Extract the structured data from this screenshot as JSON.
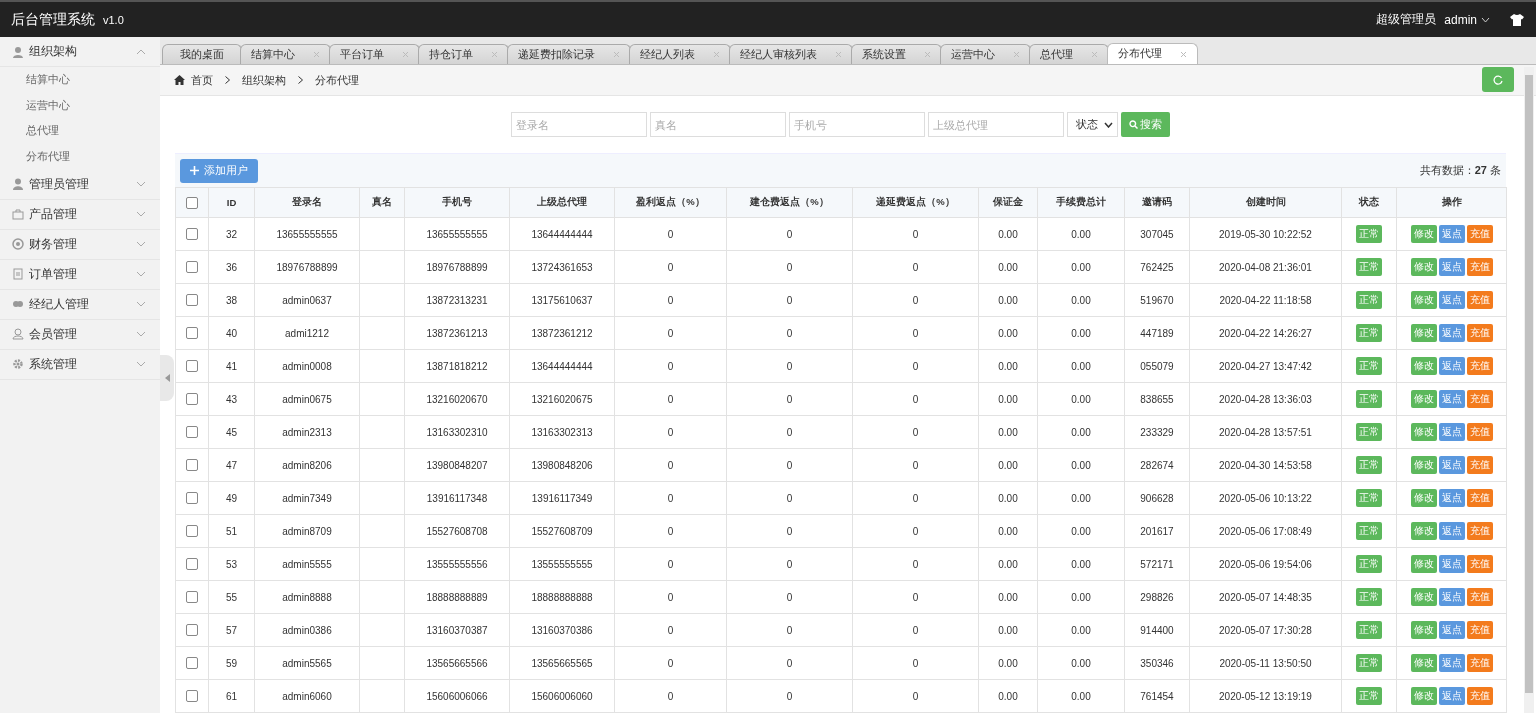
{
  "header": {
    "title": "后台管理系统",
    "version": "v1.0",
    "role": "超级管理员",
    "user": "admin"
  },
  "sidebar": [
    {
      "label": "组织架构",
      "expanded": true,
      "children": [
        {
          "label": "结算中心"
        },
        {
          "label": "运营中心"
        },
        {
          "label": "总代理"
        },
        {
          "label": "分布代理"
        }
      ]
    },
    {
      "label": "管理员管理",
      "expanded": false
    },
    {
      "label": "产品管理",
      "expanded": false
    },
    {
      "label": "财务管理",
      "expanded": false
    },
    {
      "label": "订单管理",
      "expanded": false
    },
    {
      "label": "经纪人管理",
      "expanded": false
    },
    {
      "label": "会员管理",
      "expanded": false
    },
    {
      "label": "系统管理",
      "expanded": false
    }
  ],
  "tabs": [
    {
      "label": "我的桌面",
      "closable": false,
      "selected": false
    },
    {
      "label": "结算中心",
      "closable": true,
      "selected": false
    },
    {
      "label": "平台订单",
      "closable": true,
      "selected": false
    },
    {
      "label": "持仓订单",
      "closable": true,
      "selected": false
    },
    {
      "label": "递延费扣除记录",
      "closable": true,
      "selected": false
    },
    {
      "label": "经纪人列表",
      "closable": true,
      "selected": false
    },
    {
      "label": "经纪人审核列表",
      "closable": true,
      "selected": false
    },
    {
      "label": "系统设置",
      "closable": true,
      "selected": false
    },
    {
      "label": "运营中心",
      "closable": true,
      "selected": false
    },
    {
      "label": "总代理",
      "closable": true,
      "selected": false
    },
    {
      "label": "分布代理",
      "closable": true,
      "selected": true
    }
  ],
  "breadcrumb": [
    "首页",
    "组织架构",
    "分布代理"
  ],
  "search": {
    "fields": [
      {
        "placeholder": "登录名"
      },
      {
        "placeholder": "真名"
      },
      {
        "placeholder": "手机号"
      },
      {
        "placeholder": "上级总代理"
      }
    ],
    "status_select": "状态",
    "button": "搜索"
  },
  "toolbar": {
    "add_button": "添加用户",
    "total": "共有数据：**27** 条"
  },
  "table": {
    "select_all_checked": false,
    "columns": [
      "ID",
      "登录名",
      "真名",
      "手机号",
      "上级总代理",
      "盈利返点（%）",
      "建仓费返点（%）",
      "递延费返点（%）",
      "保证金",
      "手续费总计",
      "邀请码",
      "创建时间",
      "状态",
      "操作"
    ],
    "rows": [
      {
        "checked": false,
        "cells": [
          "32",
          "13655555555",
          "",
          "13655555555",
          "13644444444",
          "0",
          "0",
          "0",
          "0.00",
          "0.00",
          "307045",
          "2019-05-30 10:22:52"
        ],
        "status": "正常",
        "actions": [
          "修改",
          "返点",
          "充值"
        ]
      },
      {
        "checked": false,
        "cells": [
          "36",
          "18976788899",
          "",
          "18976788899",
          "13724361653",
          "0",
          "0",
          "0",
          "0.00",
          "0.00",
          "762425",
          "2020-04-08 21:36:01"
        ],
        "status": "正常",
        "actions": [
          "修改",
          "返点",
          "充值"
        ]
      },
      {
        "checked": false,
        "cells": [
          "38",
          "admin0637",
          "",
          "13872313231",
          "13175610637",
          "0",
          "0",
          "0",
          "0.00",
          "0.00",
          "519670",
          "2020-04-22 11:18:58"
        ],
        "status": "正常",
        "actions": [
          "修改",
          "返点",
          "充值"
        ]
      },
      {
        "checked": false,
        "cells": [
          "40",
          "admi1212",
          "",
          "13872361213",
          "13872361212",
          "0",
          "0",
          "0",
          "0.00",
          "0.00",
          "447189",
          "2020-04-22 14:26:27"
        ],
        "status": "正常",
        "actions": [
          "修改",
          "返点",
          "充值"
        ]
      },
      {
        "checked": false,
        "cells": [
          "41",
          "admin0008",
          "",
          "13871818212",
          "13644444444",
          "0",
          "0",
          "0",
          "0.00",
          "0.00",
          "055079",
          "2020-04-27 13:47:42"
        ],
        "status": "正常",
        "actions": [
          "修改",
          "返点",
          "充值"
        ]
      },
      {
        "checked": false,
        "cells": [
          "43",
          "admin0675",
          "",
          "13216020670",
          "13216020675",
          "0",
          "0",
          "0",
          "0.00",
          "0.00",
          "838655",
          "2020-04-28 13:36:03"
        ],
        "status": "正常",
        "actions": [
          "修改",
          "返点",
          "充值"
        ]
      },
      {
        "checked": false,
        "cells": [
          "45",
          "admin2313",
          "",
          "13163302310",
          "13163302313",
          "0",
          "0",
          "0",
          "0.00",
          "0.00",
          "233329",
          "2020-04-28 13:57:51"
        ],
        "status": "正常",
        "actions": [
          "修改",
          "返点",
          "充值"
        ]
      },
      {
        "checked": false,
        "cells": [
          "47",
          "admin8206",
          "",
          "13980848207",
          "13980848206",
          "0",
          "0",
          "0",
          "0.00",
          "0.00",
          "282674",
          "2020-04-30 14:53:58"
        ],
        "status": "正常",
        "actions": [
          "修改",
          "返点",
          "充值"
        ]
      },
      {
        "checked": false,
        "cells": [
          "49",
          "admin7349",
          "",
          "13916117348",
          "13916117349",
          "0",
          "0",
          "0",
          "0.00",
          "0.00",
          "906628",
          "2020-05-06 10:13:22"
        ],
        "status": "正常",
        "actions": [
          "修改",
          "返点",
          "充值"
        ]
      },
      {
        "checked": false,
        "cells": [
          "51",
          "admin8709",
          "",
          "15527608708",
          "15527608709",
          "0",
          "0",
          "0",
          "0.00",
          "0.00",
          "201617",
          "2020-05-06 17:08:49"
        ],
        "status": "正常",
        "actions": [
          "修改",
          "返点",
          "充值"
        ]
      },
      {
        "checked": false,
        "cells": [
          "53",
          "admin5555",
          "",
          "13555555556",
          "13555555555",
          "0",
          "0",
          "0",
          "0.00",
          "0.00",
          "572171",
          "2020-05-06 19:54:06"
        ],
        "status": "正常",
        "actions": [
          "修改",
          "返点",
          "充值"
        ]
      },
      {
        "checked": false,
        "cells": [
          "55",
          "admin8888",
          "",
          "18888888889",
          "18888888888",
          "0",
          "0",
          "0",
          "0.00",
          "0.00",
          "298826",
          "2020-05-07 14:48:35"
        ],
        "status": "正常",
        "actions": [
          "修改",
          "返点",
          "充值"
        ]
      },
      {
        "checked": false,
        "cells": [
          "57",
          "admin0386",
          "",
          "13160370387",
          "13160370386",
          "0",
          "0",
          "0",
          "0.00",
          "0.00",
          "914400",
          "2020-05-07 17:30:28"
        ],
        "status": "正常",
        "actions": [
          "修改",
          "返点",
          "充值"
        ]
      },
      {
        "checked": false,
        "cells": [
          "59",
          "admin5565",
          "",
          "13565665566",
          "13565665565",
          "0",
          "0",
          "0",
          "0.00",
          "0.00",
          "350346",
          "2020-05-11 13:50:50"
        ],
        "status": "正常",
        "actions": [
          "修改",
          "返点",
          "充值"
        ]
      },
      {
        "checked": false,
        "cells": [
          "61",
          "admin6060",
          "",
          "15606006066",
          "15606006060",
          "0",
          "0",
          "0",
          "0.00",
          "0.00",
          "761454",
          "2020-05-12 13:19:19"
        ],
        "status": "正常",
        "actions": [
          "修改",
          "返点",
          "充值"
        ]
      }
    ]
  }
}
